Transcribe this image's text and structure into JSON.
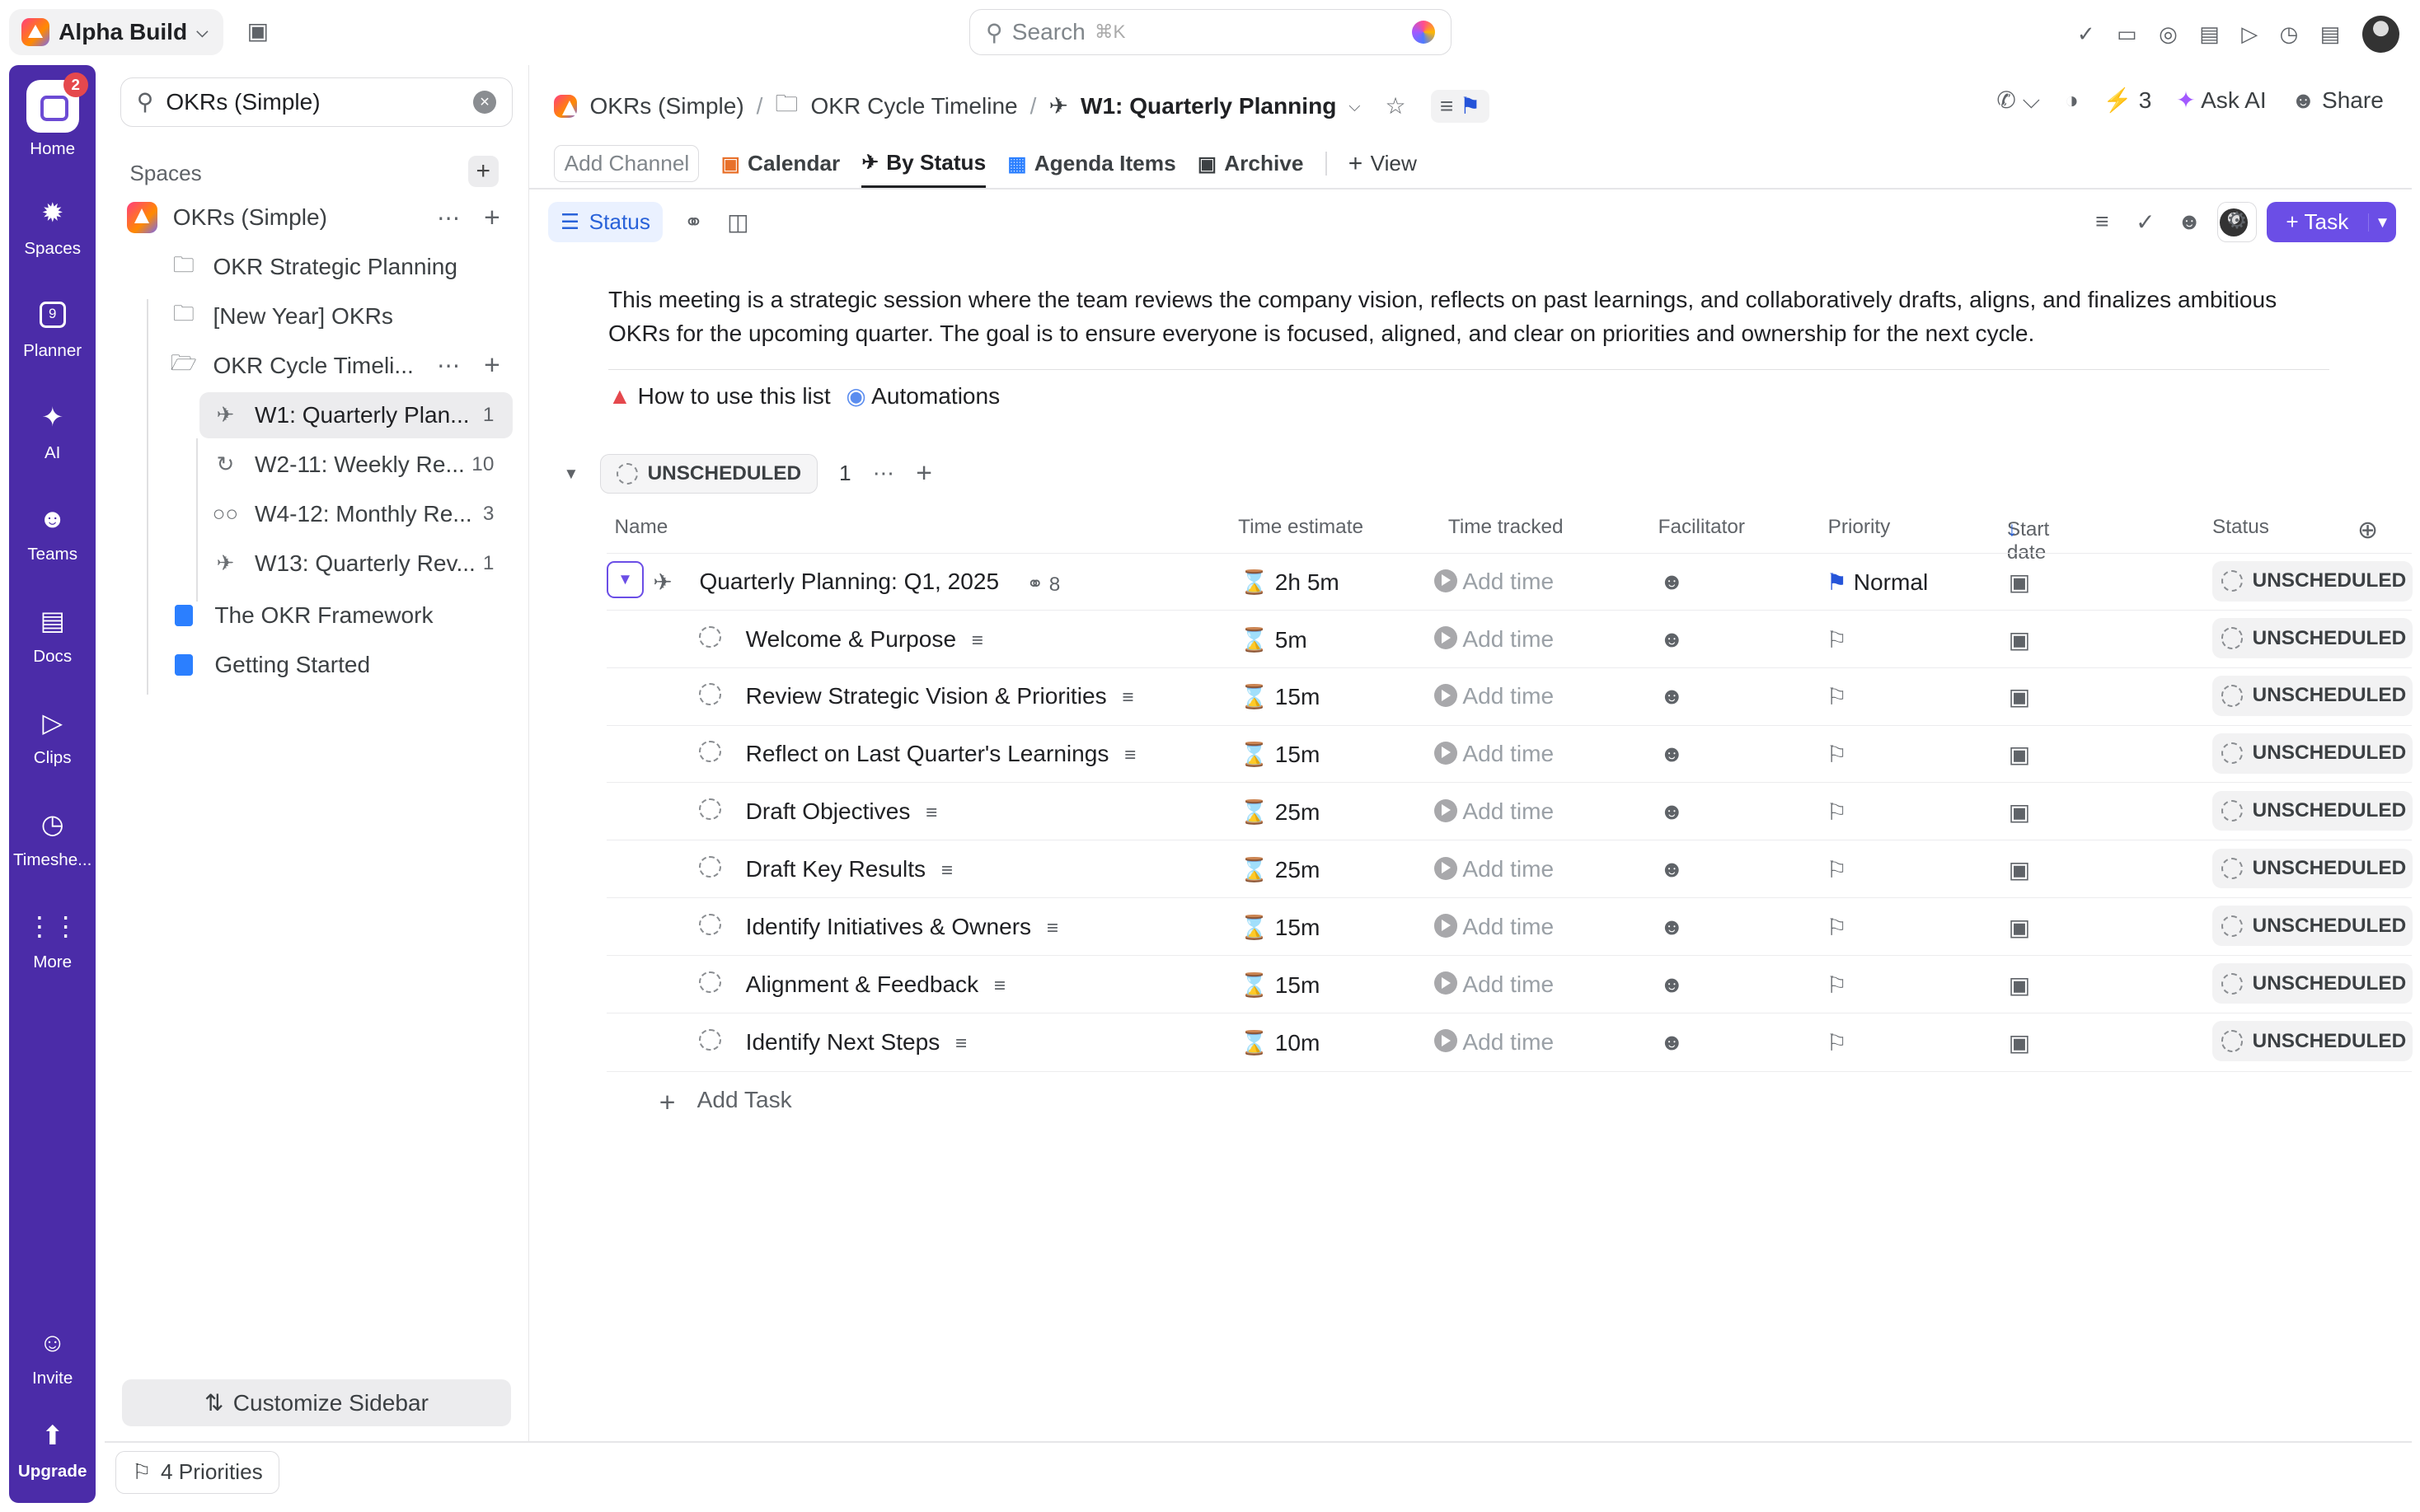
{
  "workspace": {
    "name": "Alpha Build"
  },
  "search": {
    "placeholder": "Search",
    "shortcut": "⌘K"
  },
  "rail": {
    "home_badge": "2",
    "items": [
      {
        "label": "Home"
      },
      {
        "label": "Spaces"
      },
      {
        "label": "Planner"
      },
      {
        "label": "AI"
      },
      {
        "label": "Teams"
      },
      {
        "label": "Docs"
      },
      {
        "label": "Clips"
      },
      {
        "label": "Timeshe..."
      },
      {
        "label": "More"
      },
      {
        "label": "Invite"
      },
      {
        "label": "Upgrade"
      }
    ],
    "planner_day": "9"
  },
  "sidebar": {
    "search_value": "OKRs (Simple)",
    "spaces_heading": "Spaces",
    "space_name": "OKRs (Simple)",
    "items": [
      {
        "label": "OKR Strategic Planning"
      },
      {
        "label": "[New Year] OKRs"
      },
      {
        "label": "OKR Cycle Timeli..."
      },
      {
        "label": "W1: Quarterly Plan...",
        "count": "1"
      },
      {
        "label": "W2-11: Weekly Re...",
        "count": "10"
      },
      {
        "label": "W4-12: Monthly Re...",
        "count": "3"
      },
      {
        "label": "W13: Quarterly Rev...",
        "count": "1"
      },
      {
        "label": "The OKR Framework"
      },
      {
        "label": "Getting Started"
      }
    ],
    "customize": "Customize Sidebar",
    "priorities": "4 Priorities"
  },
  "breadcrumb": {
    "space": "OKRs (Simple)",
    "folder": "OKR Cycle Timeline",
    "list": "W1: Quarterly Planning"
  },
  "header": {
    "count": "3",
    "ask_ai": "Ask AI",
    "share": "Share"
  },
  "tabs": {
    "add_channel": "Add Channel",
    "items": [
      {
        "label": "Calendar"
      },
      {
        "label": "By Status"
      },
      {
        "label": "Agenda Items"
      },
      {
        "label": "Archive"
      }
    ],
    "view": "View"
  },
  "toolbar": {
    "status": "Status",
    "task": "Task"
  },
  "description": "This meeting is a strategic session where the team reviews the company vision, reflects on past learnings, and collaboratively drafts, aligns, and finalizes ambitious OKRs for the upcoming quarter. The goal is to ensure everyone is focused, aligned, and clear on priorities and ownership for the next cycle.",
  "links": {
    "how_to": "How to use this list",
    "automations": "Automations"
  },
  "group": {
    "label": "UNSCHEDULED",
    "count": "1"
  },
  "columns": {
    "name": "Name",
    "time_estimate": "Time estimate",
    "time_tracked": "Time tracked",
    "facilitator": "Facilitator",
    "priority": "Priority",
    "start_date": "Start date",
    "status": "Status"
  },
  "parent_task": {
    "name": "Quarterly Planning: Q1, 2025",
    "subtasks": "8",
    "estimate": "2h 5m",
    "tracked": "Add time",
    "priority": "Normal",
    "status": "UNSCHEDULED"
  },
  "subtasks": [
    {
      "name": "Welcome & Purpose",
      "estimate": "5m"
    },
    {
      "name": "Review Strategic Vision & Priorities",
      "estimate": "15m"
    },
    {
      "name": "Reflect on Last Quarter's Learnings",
      "estimate": "15m"
    },
    {
      "name": "Draft Objectives",
      "estimate": "25m"
    },
    {
      "name": "Draft Key Results",
      "estimate": "25m"
    },
    {
      "name": "Identify Initiatives & Owners",
      "estimate": "15m"
    },
    {
      "name": "Alignment & Feedback",
      "estimate": "15m"
    },
    {
      "name": "Identify Next Steps",
      "estimate": "10m"
    }
  ],
  "row_defaults": {
    "tracked": "Add time",
    "status": "UNSCHEDULED"
  },
  "add_task": "Add Task",
  "colors": {
    "accent": "#6b4ee6",
    "rail": "#4b2ca8",
    "priority_flag": "#2554d9"
  }
}
